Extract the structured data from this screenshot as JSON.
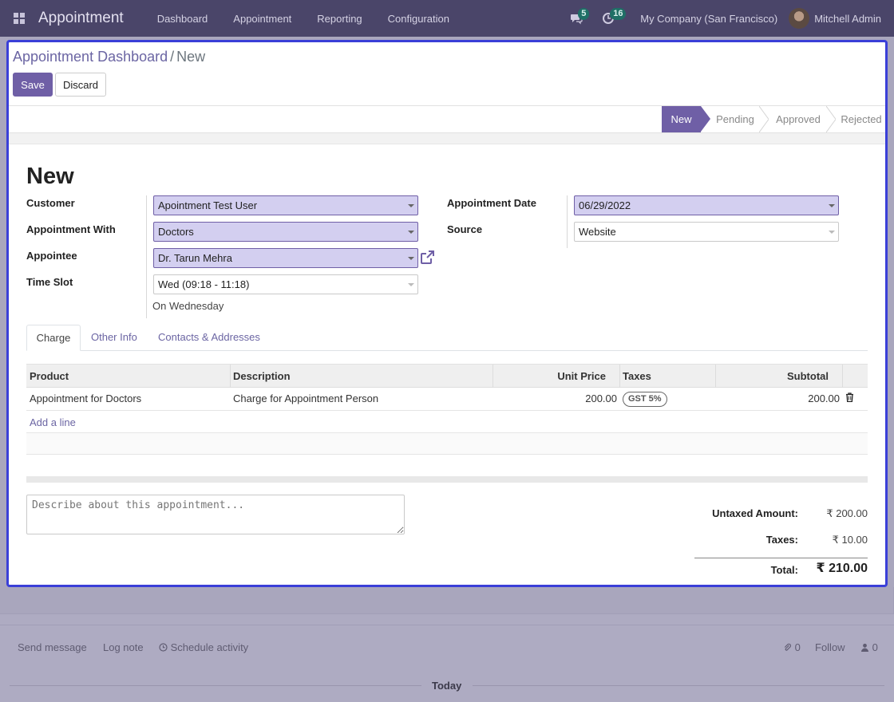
{
  "navbar": {
    "brand": "Appointment",
    "menu": [
      "Dashboard",
      "Appointment",
      "Reporting",
      "Configuration"
    ],
    "messages_count": "5",
    "activities_count": "16",
    "company": "My Company (San Francisco)",
    "user": "Mitchell Admin",
    "accent": "#4a4569"
  },
  "breadcrumb": {
    "parent": "Appointment Dashboard",
    "separator": "/",
    "current": "New"
  },
  "actions": {
    "save": "Save",
    "discard": "Discard"
  },
  "statusbar": {
    "stages": [
      "New",
      "Pending",
      "Approved",
      "Rejected"
    ],
    "active": "New"
  },
  "form": {
    "title": "New",
    "customer_label": "Customer",
    "customer": "Apointment Test User",
    "appointment_with_label": "Appointment With",
    "appointment_with": "Doctors",
    "appointee_label": "Appointee",
    "appointee": "Dr. Tarun Mehra",
    "time_slot_label": "Time Slot",
    "time_slot": "Wed (09:18 - 11:18)",
    "time_slot_note": "On Wednesday",
    "date_label": "Appointment Date",
    "date": "06/29/2022",
    "source_label": "Source",
    "source": "Website"
  },
  "tabs": [
    "Charge",
    "Other Info",
    "Contacts & Addresses"
  ],
  "lines": {
    "headers": {
      "product": "Product",
      "description": "Description",
      "unit_price": "Unit Price",
      "taxes": "Taxes",
      "subtotal": "Subtotal"
    },
    "rows": [
      {
        "product": "Appointment for Doctors",
        "description": "Charge for Appointment Person",
        "unit_price": "200.00",
        "tax": "GST 5%",
        "subtotal": "200.00"
      }
    ],
    "add_line": "Add a line"
  },
  "notes_placeholder": "Describe about this appointment...",
  "totals": {
    "untaxed_label": "Untaxed Amount:",
    "untaxed": "₹ 200.00",
    "taxes_label": "Taxes:",
    "taxes": "₹ 10.00",
    "total_label": "Total:",
    "total": "₹ 210.00"
  },
  "chatter": {
    "send_message": "Send message",
    "log_note": "Log note",
    "schedule_activity": "Schedule activity",
    "attachments": "0",
    "follow": "Follow",
    "followers": "0",
    "today": "Today"
  }
}
